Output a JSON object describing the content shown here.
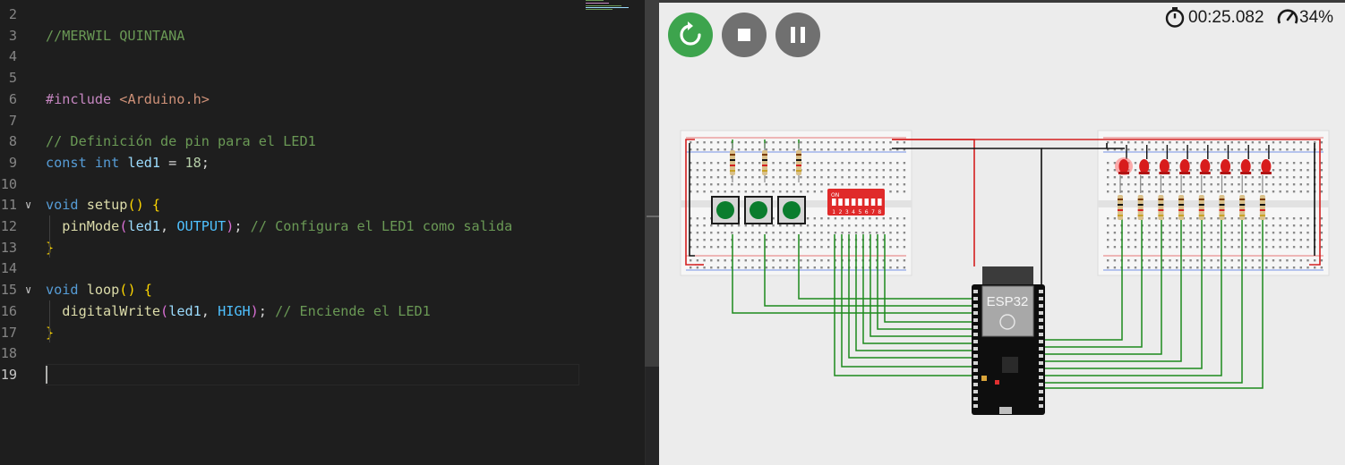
{
  "editor": {
    "lines": [
      {
        "n": "2",
        "tokens": []
      },
      {
        "n": "3",
        "tokens": [
          {
            "c": "t-com",
            "t": "//MERWIL QUINTANA"
          }
        ]
      },
      {
        "n": "4",
        "tokens": []
      },
      {
        "n": "5",
        "tokens": []
      },
      {
        "n": "6",
        "tokens": [
          {
            "c": "t-ctl",
            "t": "#include "
          },
          {
            "c": "t-str",
            "t": "<Arduino.h>"
          }
        ]
      },
      {
        "n": "7",
        "tokens": []
      },
      {
        "n": "8",
        "tokens": [
          {
            "c": "t-com",
            "t": "// Definición de pin para el LED1"
          }
        ]
      },
      {
        "n": "9",
        "tokens": [
          {
            "c": "t-kw",
            "t": "const "
          },
          {
            "c": "t-kw",
            "t": "int "
          },
          {
            "c": "t-var",
            "t": "led1"
          },
          {
            "c": "t-pl",
            "t": " = "
          },
          {
            "c": "t-num",
            "t": "18"
          },
          {
            "c": "t-pl",
            "t": ";"
          }
        ]
      },
      {
        "n": "10",
        "tokens": []
      },
      {
        "n": "11",
        "fold": "true",
        "tokens": [
          {
            "c": "t-kw",
            "t": "void "
          },
          {
            "c": "t-fn",
            "t": "setup"
          },
          {
            "c": "t-br1",
            "t": "() {"
          }
        ]
      },
      {
        "n": "12",
        "tokens": [
          {
            "c": "t-pl",
            "t": "  "
          },
          {
            "c": "t-fn",
            "t": "pinMode"
          },
          {
            "c": "t-br2",
            "t": "("
          },
          {
            "c": "t-var",
            "t": "led1"
          },
          {
            "c": "t-pl",
            "t": ", "
          },
          {
            "c": "t-cst",
            "t": "OUTPUT"
          },
          {
            "c": "t-br2",
            "t": ")"
          },
          {
            "c": "t-pl",
            "t": "; "
          },
          {
            "c": "t-com",
            "t": "// Configura el LED1 como salida"
          }
        ]
      },
      {
        "n": "13",
        "tokens": [
          {
            "c": "t-br1",
            "t": "}"
          }
        ]
      },
      {
        "n": "14",
        "tokens": []
      },
      {
        "n": "15",
        "fold": "true",
        "tokens": [
          {
            "c": "t-kw",
            "t": "void "
          },
          {
            "c": "t-fn",
            "t": "loop"
          },
          {
            "c": "t-br1",
            "t": "() {"
          }
        ]
      },
      {
        "n": "16",
        "tokens": [
          {
            "c": "t-pl",
            "t": "  "
          },
          {
            "c": "t-fn",
            "t": "digitalWrite"
          },
          {
            "c": "t-br2",
            "t": "("
          },
          {
            "c": "t-var",
            "t": "led1"
          },
          {
            "c": "t-pl",
            "t": ", "
          },
          {
            "c": "t-cst",
            "t": "HIGH"
          },
          {
            "c": "t-br2",
            "t": ")"
          },
          {
            "c": "t-pl",
            "t": "; "
          },
          {
            "c": "t-com",
            "t": "// Enciende el LED1"
          }
        ]
      },
      {
        "n": "17",
        "tokens": [
          {
            "c": "t-br1",
            "t": "}"
          }
        ]
      },
      {
        "n": "18",
        "tokens": []
      },
      {
        "n": "19",
        "active": "true",
        "tokens": []
      }
    ]
  },
  "simulator": {
    "timer": "00:25.082",
    "speed": "34%",
    "board_label": "ESP32",
    "dip_label": "ON",
    "dip_numbers": [
      "1",
      "2",
      "3",
      "4",
      "5",
      "6",
      "7",
      "8"
    ],
    "led_states": [
      true,
      false,
      false,
      false,
      false,
      false,
      false,
      false
    ],
    "colors": {
      "restart": "#3da44d",
      "stop": "#707070",
      "pause": "#707070",
      "wire": "#1d8a1d",
      "power": "#d42020",
      "ground": "#111111",
      "led": "#d81c1c",
      "button": "#0a7d2d",
      "dip": "#e02a2a"
    },
    "icons": [
      "restart-icon",
      "stop-icon",
      "pause-icon",
      "stopwatch-icon",
      "speedometer-icon"
    ]
  }
}
